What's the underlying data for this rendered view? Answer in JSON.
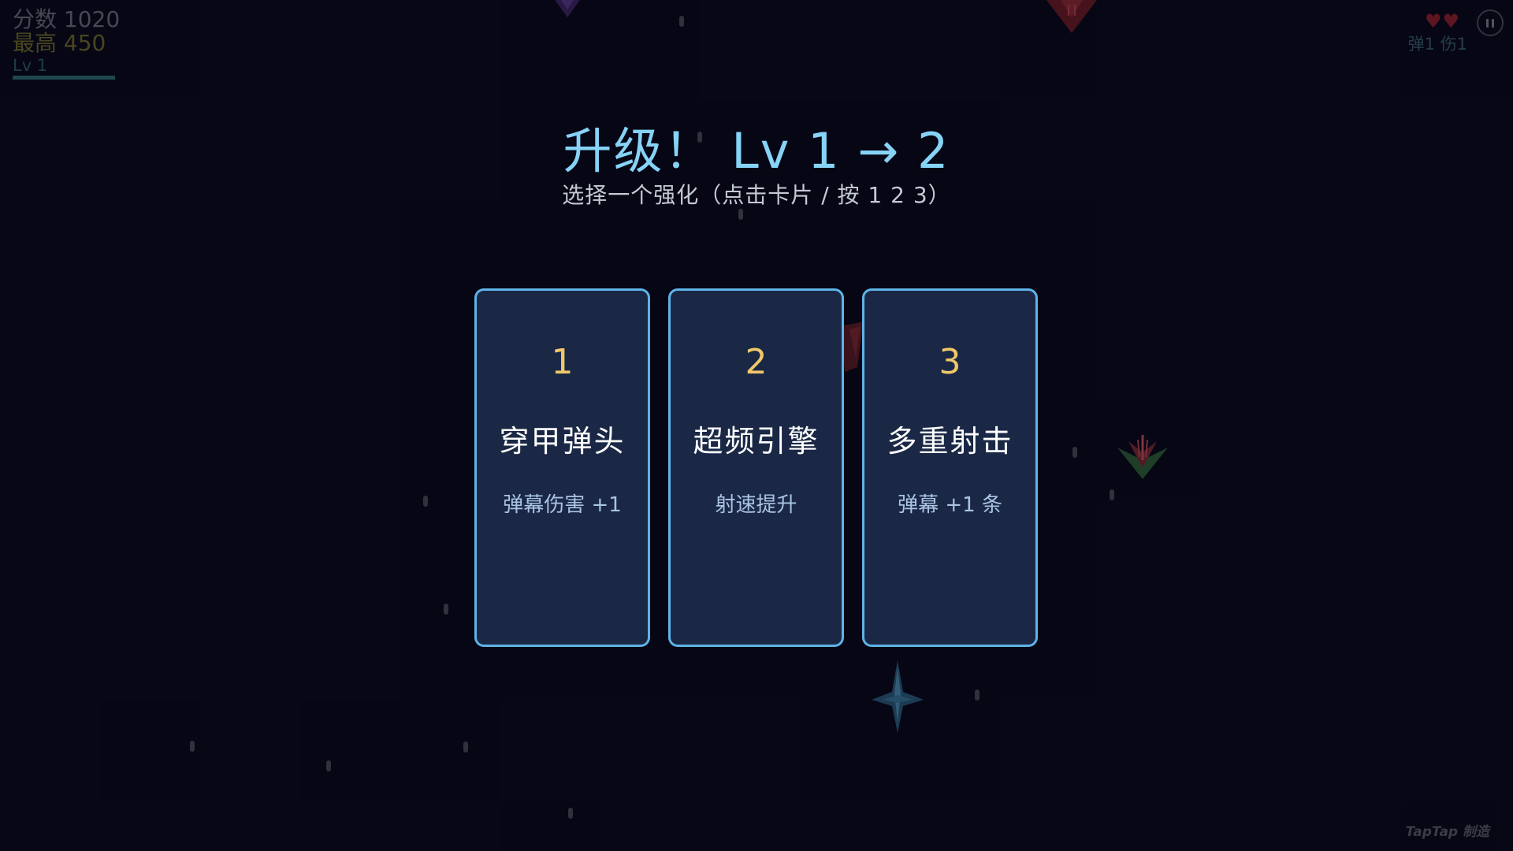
{
  "hud": {
    "score_label": "分数 1020",
    "best_label": "最高 450",
    "level_label": "Lv 1",
    "xp_progress": 1.0,
    "lives": [
      "♥",
      "♥"
    ],
    "stats_label": "弹1 伤1",
    "pause_icon": "pause-icon"
  },
  "upgrade": {
    "title": "升级！ Lv 1 → 2",
    "subtitle": "选择一个强化（点击卡片 / 按 1 2 3）",
    "cards": [
      {
        "number": "1",
        "name": "穿甲弹头",
        "desc": "弹幕伤害 +1"
      },
      {
        "number": "2",
        "name": "超频引擎",
        "desc": "射速提升"
      },
      {
        "number": "3",
        "name": "多重射击",
        "desc": "弹幕 +1 条"
      }
    ]
  },
  "watermark": "TapTap 制造",
  "colors": {
    "background": "#080919",
    "card_bg": "#1a2846",
    "card_border": "#5fb3e8",
    "title": "#86d3f6",
    "card_number": "#f0c86a",
    "life": "#8e1f28"
  },
  "icons": {
    "enemy": "enemy-ship-icon",
    "player": "player-ship-icon",
    "life": "heart-icon"
  }
}
